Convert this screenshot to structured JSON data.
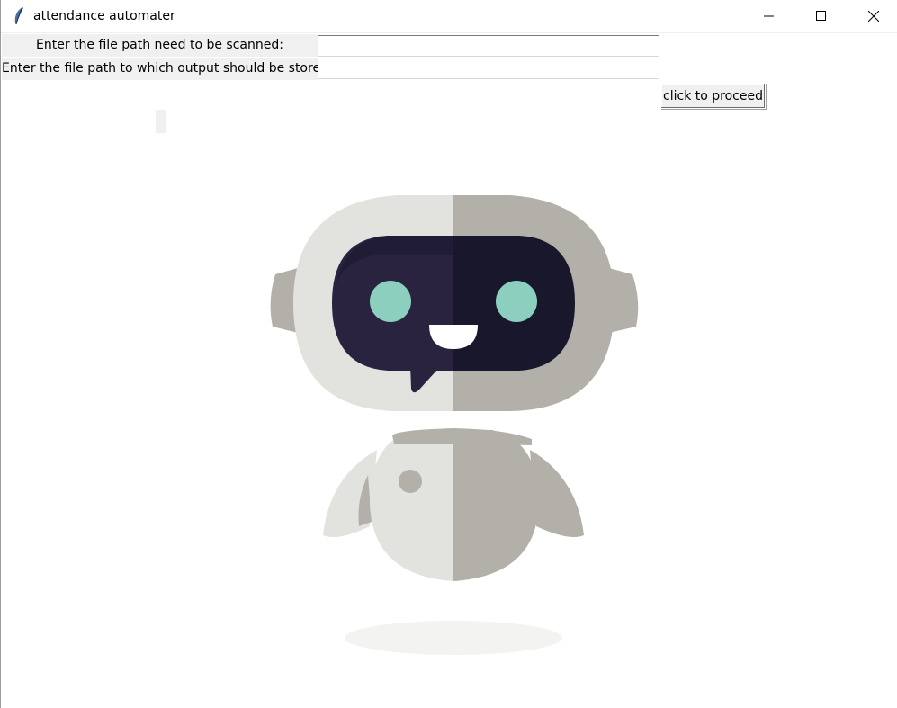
{
  "window": {
    "title": "attendance automater",
    "controls": {
      "minimize": "minimize-icon",
      "maximize": "maximize-icon",
      "close": "close-icon"
    }
  },
  "form": {
    "scan_label": "Enter the file path need to be scanned:",
    "scan_value": "",
    "output_label": "Enter the file path to which output should be stored:",
    "output_value": "",
    "proceed_label": "click to proceed"
  },
  "status": {
    "text": ""
  },
  "image": {
    "subject": "robot-mascot",
    "colors": {
      "light": "#e2e3df",
      "shade": "#b3b0aa",
      "visor_dark": "#19172c",
      "visor_light": "#29233f",
      "eyes": "#8ccfbf",
      "mouth": "#ffffff",
      "shadow": "#f3f3f1"
    }
  }
}
